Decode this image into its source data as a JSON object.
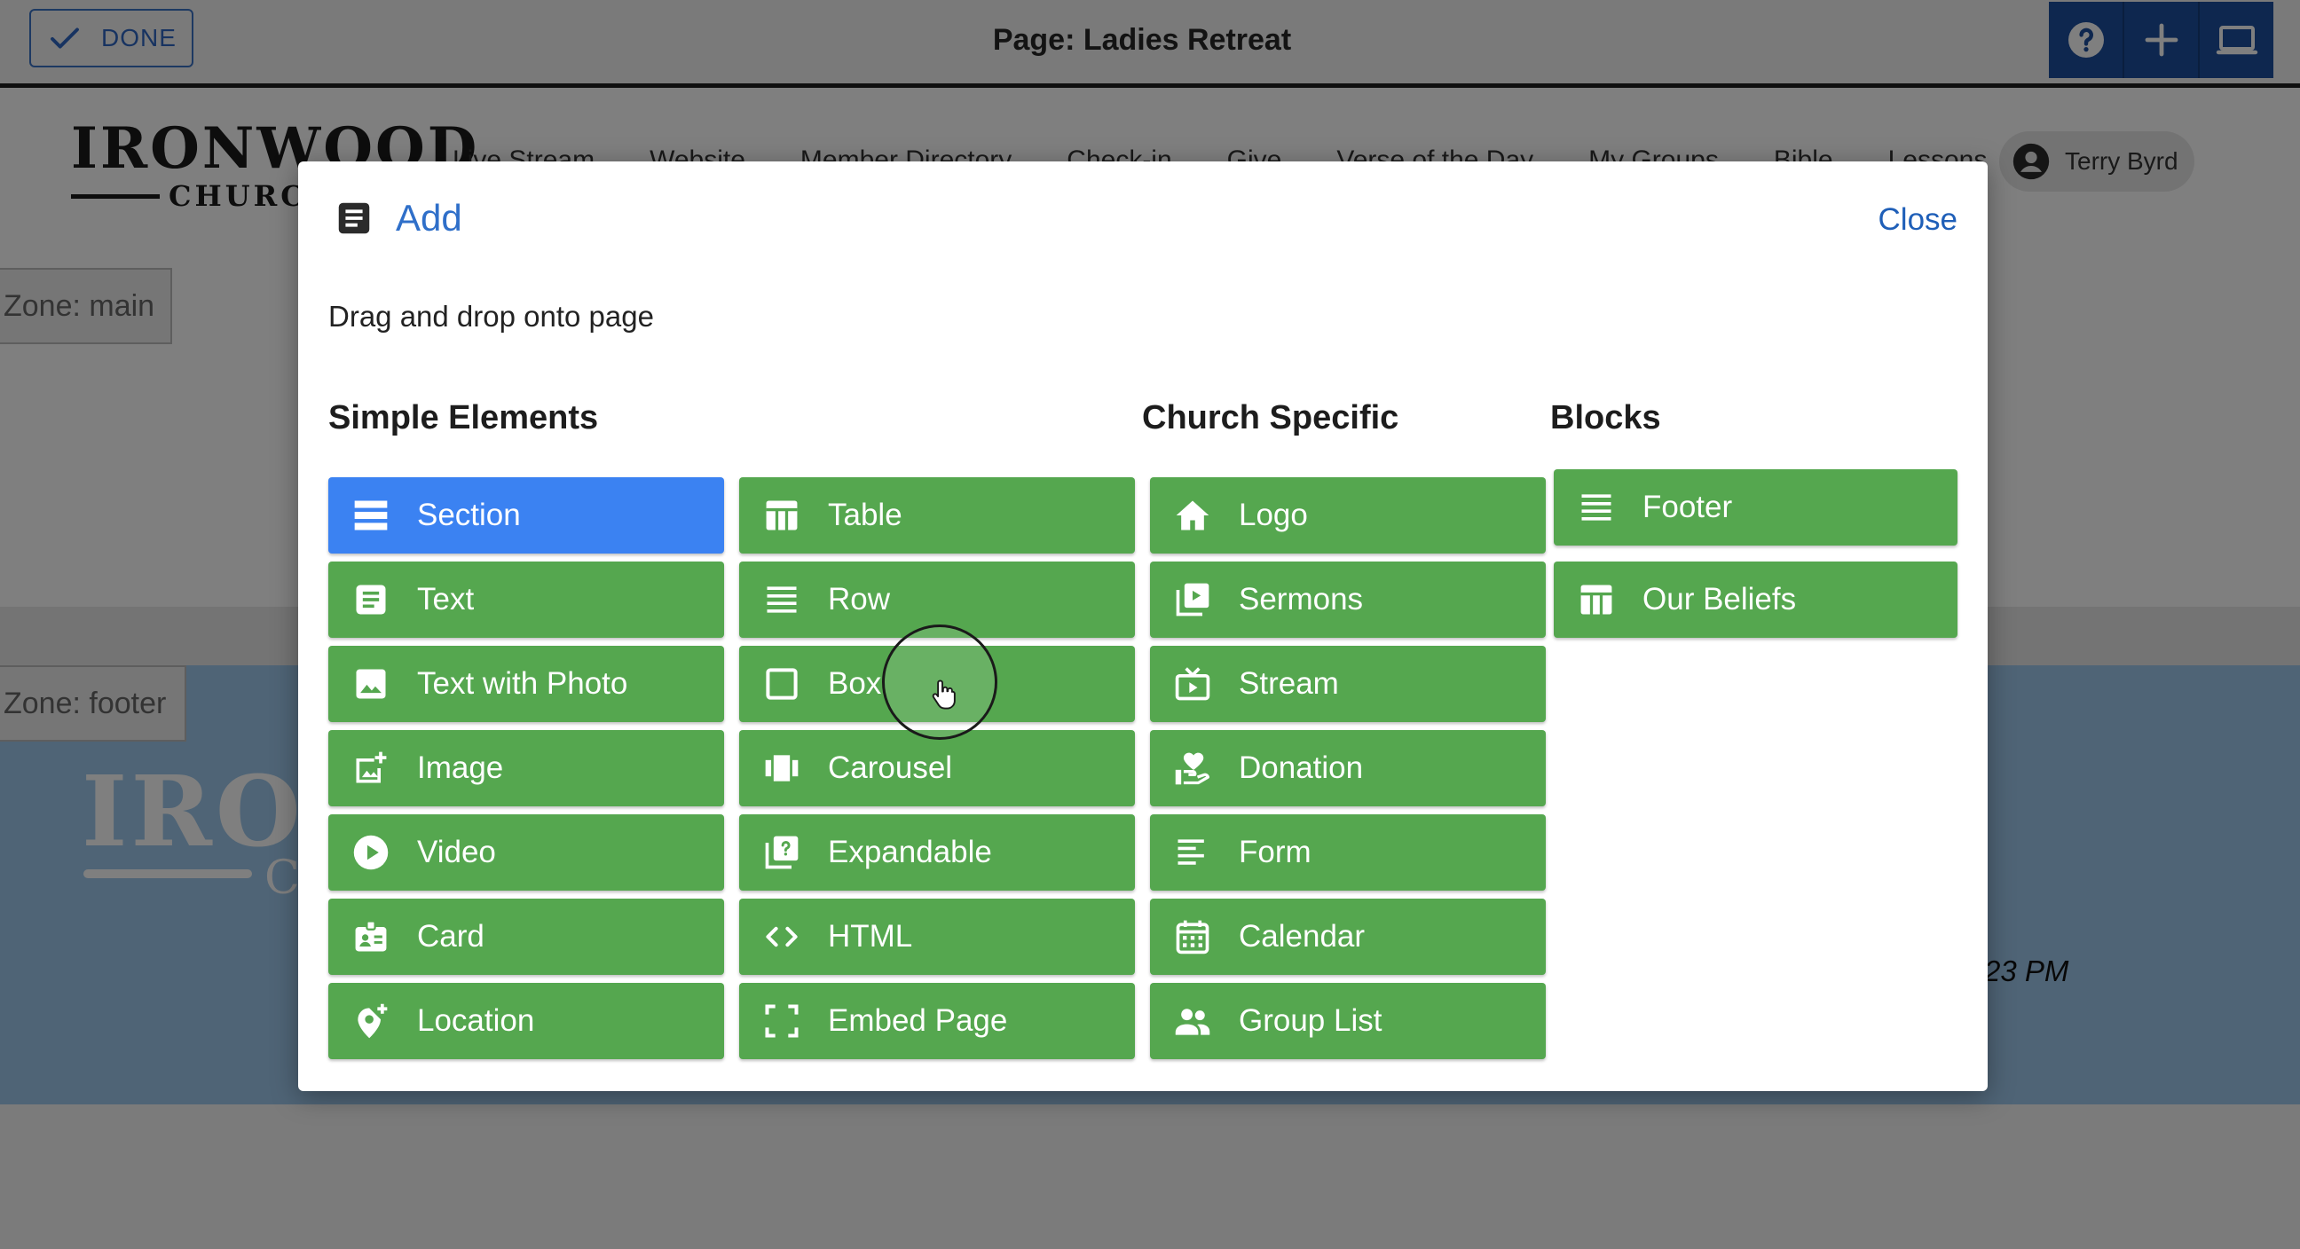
{
  "toolbar": {
    "done_label": "DONE",
    "page_title": "Page: Ladies Retreat",
    "icons": [
      "help-icon",
      "plus-icon",
      "monitor-icon"
    ]
  },
  "site": {
    "logo_main": "IRONWOOD",
    "logo_sub": "CHURC",
    "nav": [
      "Live Stream",
      "Website",
      "Member Directory",
      "Check-in",
      "Give",
      "Verse of the Day",
      "My Groups",
      "Bible",
      "Lessons"
    ],
    "user_name": "Terry Byrd",
    "zone_main": "Zone: main",
    "zone_footer": "Zone: footer",
    "footer_logo": "IRO",
    "footer_logo_c": "C",
    "footer_time": "23 PM"
  },
  "modal": {
    "title": "Add",
    "close_label": "Close",
    "description": "Drag and drop onto page",
    "headings": {
      "simple": "Simple Elements",
      "church": "Church Specific",
      "blocks": "Blocks"
    },
    "simple_col1": [
      {
        "label": "Section",
        "icon": "section-icon"
      },
      {
        "label": "Text",
        "icon": "text-icon"
      },
      {
        "label": "Text with Photo",
        "icon": "photo-icon"
      },
      {
        "label": "Image",
        "icon": "add-image-icon"
      },
      {
        "label": "Video",
        "icon": "play-icon"
      },
      {
        "label": "Card",
        "icon": "card-icon"
      },
      {
        "label": "Location",
        "icon": "location-icon"
      }
    ],
    "simple_col2": [
      {
        "label": "Table",
        "icon": "table-icon"
      },
      {
        "label": "Row",
        "icon": "row-icon"
      },
      {
        "label": "Box",
        "icon": "box-icon"
      },
      {
        "label": "Carousel",
        "icon": "carousel-icon"
      },
      {
        "label": "Expandable",
        "icon": "expandable-icon"
      },
      {
        "label": "HTML",
        "icon": "code-icon"
      },
      {
        "label": "Embed Page",
        "icon": "embed-icon"
      }
    ],
    "church": [
      {
        "label": "Logo",
        "icon": "home-icon"
      },
      {
        "label": "Sermons",
        "icon": "sermons-icon"
      },
      {
        "label": "Stream",
        "icon": "tv-icon"
      },
      {
        "label": "Donation",
        "icon": "donation-icon"
      },
      {
        "label": "Form",
        "icon": "form-icon"
      },
      {
        "label": "Calendar",
        "icon": "calendar-icon"
      },
      {
        "label": "Group List",
        "icon": "group-icon"
      }
    ],
    "blocks": [
      {
        "label": "Footer",
        "icon": "footer-icon"
      },
      {
        "label": "Our Beliefs",
        "icon": "table-icon"
      }
    ]
  },
  "colors": {
    "element_green": "#55a74f",
    "section_blue": "#3b82f2",
    "link_blue": "#2f6fc9",
    "toolbar_blue": "#1c4f9e"
  }
}
